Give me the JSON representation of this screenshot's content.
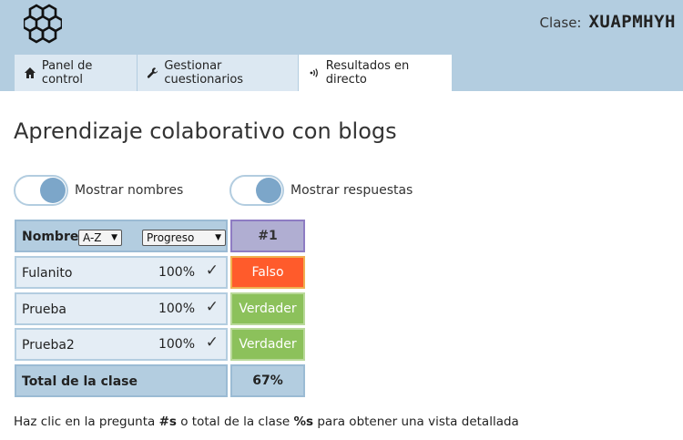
{
  "header": {
    "class_label": "Clase:",
    "class_code": "XUAPMHYH"
  },
  "nav": {
    "tabs": [
      {
        "label": "Panel de control",
        "icon": "home-icon"
      },
      {
        "label": "Gestionar cuestionarios",
        "icon": "wrench-icon"
      },
      {
        "label": "Resultados en directo",
        "icon": "broadcast-icon",
        "active": true
      }
    ]
  },
  "page": {
    "title": "Aprendizaje colaborativo con blogs"
  },
  "toggles": {
    "names_label": "Mostrar nombres",
    "answers_label": "Mostrar respuestas"
  },
  "table": {
    "header_name": "Nombre",
    "sort_select": "A-Z",
    "progress_select": "Progreso",
    "question_header": "#1",
    "rows": [
      {
        "name": "Fulanito",
        "progress": "100%",
        "check": "✓",
        "answer": "Falso",
        "correct": false
      },
      {
        "name": "Prueba",
        "progress": "100%",
        "check": "✓",
        "answer": "Verdader",
        "correct": true
      },
      {
        "name": "Prueba2",
        "progress": "100%",
        "check": "✓",
        "answer": "Verdader",
        "correct": true
      }
    ],
    "total_label": "Total de la clase",
    "total_value": "67%"
  },
  "hint": {
    "part1": "Haz clic en la pregunta ",
    "q_token": "#s",
    "part2": " o total de la clase ",
    "total_token": "%s",
    "part3": " para obtener una vista detallada"
  },
  "colors": {
    "header_bg": "#b3cde0",
    "false_bg": "#ff5b2b",
    "true_bg": "#8cc15b",
    "question_header_bg": "#b0aed2"
  }
}
